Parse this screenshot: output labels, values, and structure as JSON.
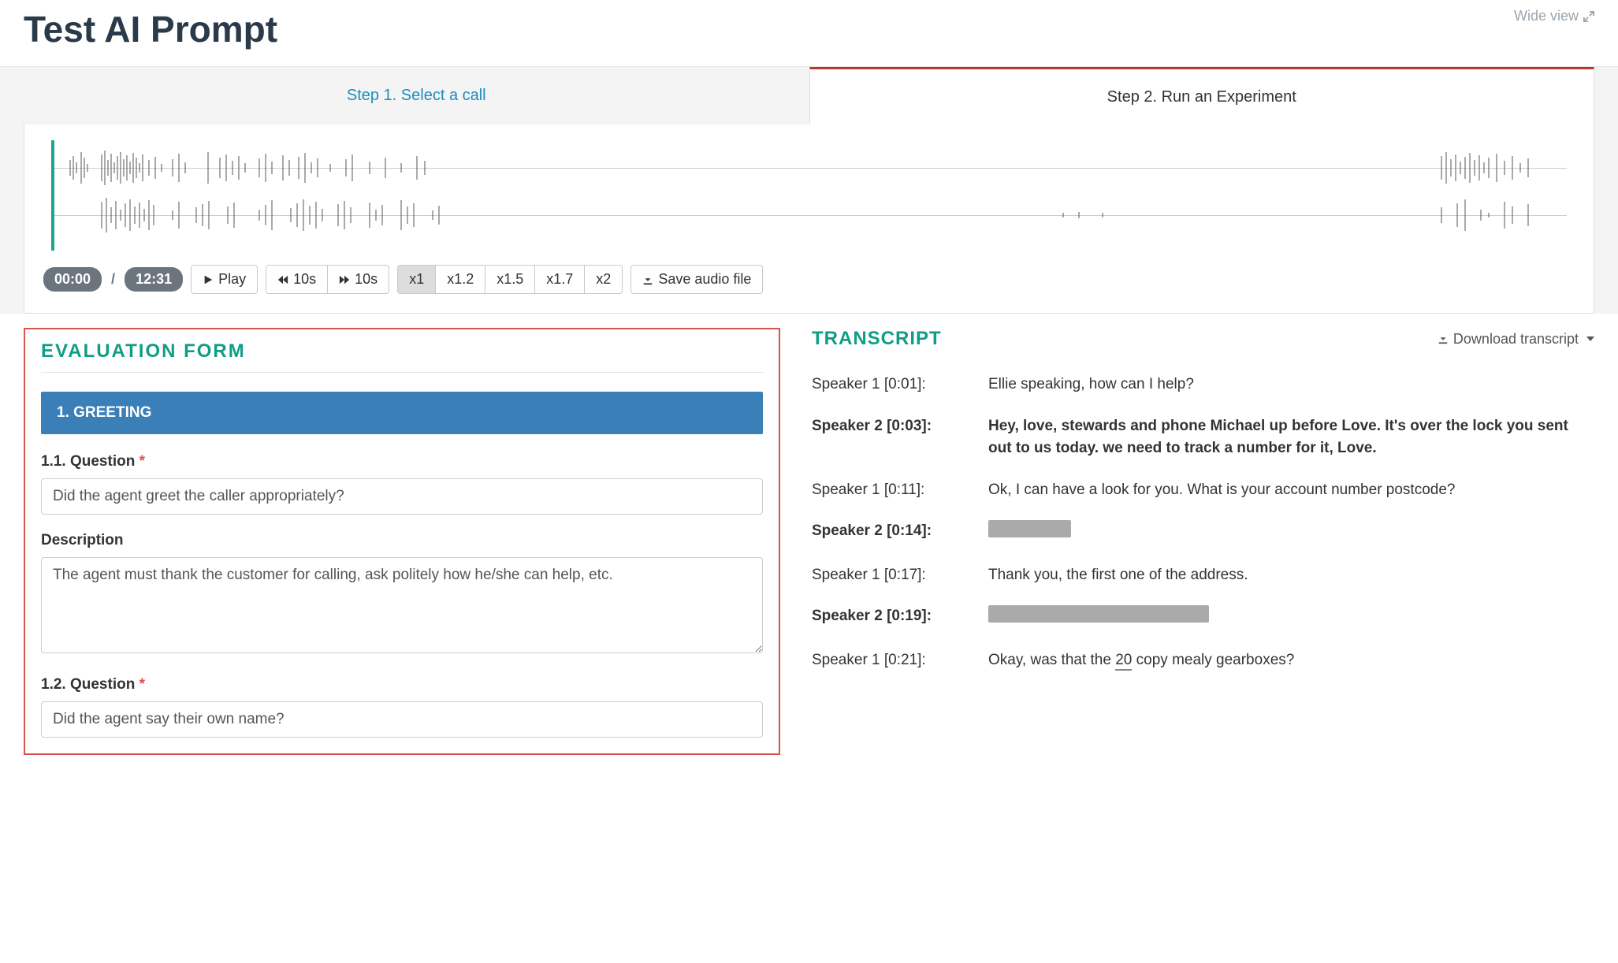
{
  "header": {
    "title": "Test AI Prompt",
    "wide_view_label": "Wide view"
  },
  "tabs": {
    "step1": "Step 1. Select a call",
    "step2": "Step 2. Run an Experiment"
  },
  "audio": {
    "current_time": "00:00",
    "duration": "12:31",
    "play_label": "Play",
    "rewind_label": "10s",
    "forward_label": "10s",
    "speeds": [
      "x1",
      "x1.2",
      "x1.5",
      "x1.7",
      "x2"
    ],
    "active_speed": "x1",
    "save_label": "Save audio file"
  },
  "evaluation": {
    "panel_title": "EVALUATION  FORM",
    "section1_header": "1. GREETING",
    "q1": {
      "label": "1.1. Question",
      "value": "Did the agent greet the caller appropriately?"
    },
    "description_label": "Description",
    "description_value": "The agent must thank the customer for calling, ask politely how he/she can help, etc.",
    "q2": {
      "label": "1.2. Question",
      "value": "Did the agent say their own name?"
    }
  },
  "transcript": {
    "panel_title": "TRANSCRIPT",
    "download_label": "Download transcript",
    "lines": [
      {
        "speaker": "Speaker 1",
        "time": "0:01",
        "bold": false,
        "text": "Ellie speaking, how can I help?",
        "redacted": false
      },
      {
        "speaker": "Speaker 2",
        "time": "0:03",
        "bold": true,
        "text": "Hey, love, stewards and phone Michael up before Love. It's over the lock you sent out to us today. we need to track a number for it, Love.",
        "redacted": false
      },
      {
        "speaker": "Speaker 1",
        "time": "0:11",
        "bold": false,
        "text": "Ok, I can have a look for you. What is your account number postcode?",
        "redacted": false
      },
      {
        "speaker": "Speaker 2",
        "time": "0:14",
        "bold": true,
        "text": "",
        "redacted": true,
        "redact_width": 105
      },
      {
        "speaker": "Speaker 1",
        "time": "0:17",
        "bold": false,
        "text": "Thank you, the first one of the address.",
        "redacted": false
      },
      {
        "speaker": "Speaker 2",
        "time": "0:19",
        "bold": true,
        "text": "",
        "redacted": true,
        "redact_width": 280
      },
      {
        "speaker": "Speaker 1",
        "time": "0:21",
        "bold": false,
        "text_prefix": "Okay, was that the ",
        "underline_word": "20",
        "text_suffix": " copy mealy gearboxes?",
        "redacted": false,
        "has_underline": true
      }
    ]
  }
}
